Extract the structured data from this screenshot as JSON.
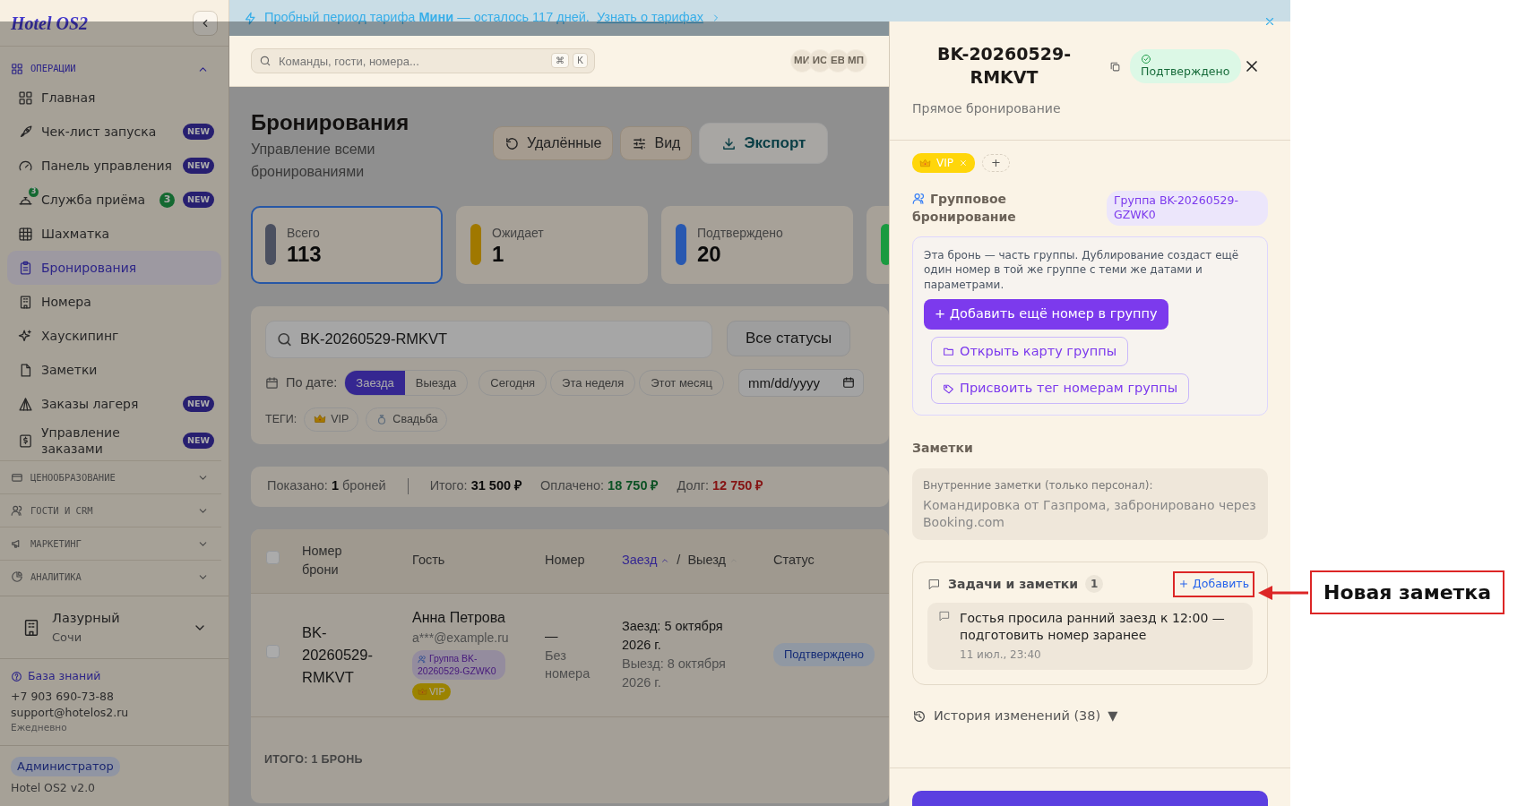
{
  "banner": {
    "text": "Пробный период тарифа **Мини** — осталось 117 дней.",
    "link": "Узнать о тарифах"
  },
  "sidebar": {
    "logo": "Hotel OS2",
    "sections": [
      {
        "title": "ОПЕРАЦИИ",
        "expanded": true,
        "items": [
          {
            "label": "Главная",
            "selected": false
          },
          {
            "label": "Чек-лист запуска",
            "badge": "NEW",
            "selected": false
          },
          {
            "label": "Панель управления",
            "badge": "NEW",
            "selected": false
          },
          {
            "label": "Служба приёма",
            "icon_count": "3",
            "count": "3",
            "badge": "NEW",
            "selected": false
          },
          {
            "label": "Шахматка",
            "selected": false
          },
          {
            "label": "Бронирования",
            "selected": true
          },
          {
            "label": "Номера",
            "selected": false
          },
          {
            "label": "Хаускипинг",
            "selected": false
          },
          {
            "label": "Заметки",
            "selected": false
          },
          {
            "label": "Заказы лагеря",
            "badge": "NEW",
            "selected": false
          },
          {
            "label": "Управление заказами",
            "badge": "NEW",
            "selected": false
          }
        ]
      },
      {
        "title": "ЦЕНООБРАЗОВАНИЕ",
        "expanded": false
      },
      {
        "title": "ГОСТИ И CRM",
        "expanded": false
      },
      {
        "title": "МАРКЕТИНГ",
        "expanded": false
      },
      {
        "title": "АНАЛИТИКА",
        "expanded": false
      }
    ],
    "property": {
      "name": "Лазурный",
      "city": "Сочи"
    },
    "help": {
      "link": "База знаний",
      "phone": "+7 903 690-73-88",
      "email": "support@hotelos2.ru",
      "hours": "Ежедневно"
    },
    "role": "Администратор",
    "version": "Hotel OS2 v2.0"
  },
  "topbar": {
    "search": {
      "placeholder": "Команды, гости, номера..."
    },
    "shortcut": [
      "⌘",
      "K"
    ],
    "avatars": [
      "МИ",
      "ИС",
      "ЕВ",
      "МП"
    ]
  },
  "page": {
    "title": "Бронирования",
    "subtitle": "Управление всеми бронированиями",
    "actions": [
      {
        "label": "Удалённые",
        "kind": "restore"
      },
      {
        "label": "Вид",
        "kind": "view"
      },
      {
        "label": "Экспорт",
        "kind": "export"
      }
    ]
  },
  "stats": [
    {
      "label": "Всего",
      "value": "113",
      "color": "#4b5060",
      "selected": true
    },
    {
      "label": "Ожидает",
      "value": "1",
      "color": "#a07800",
      "selected": false
    },
    {
      "label": "Подтверждено",
      "value": "20",
      "color": "#2858b0",
      "selected": false
    },
    {
      "color": "#1a9a40",
      "selected": false
    }
  ],
  "filters": {
    "search": {
      "value": "BK-20260529-RMKVT"
    },
    "status": "Все статусы",
    "date_label": "По дате:",
    "date_modes": [
      {
        "label": "Заезда",
        "selected": true
      },
      {
        "label": "Выезда",
        "selected": false
      }
    ],
    "quick": [
      "Сегодня",
      "Эта неделя",
      "Этот месяц"
    ],
    "date": {
      "placeholder": "mm/dd/yyyy"
    },
    "tags_label": "ТЕГИ:",
    "tags": [
      {
        "label": "VIP",
        "kind": "crown"
      },
      {
        "label": "Свадьба",
        "kind": "ring"
      }
    ]
  },
  "summary": {
    "shown": "Показано: **1** броней",
    "totals": [
      {
        "label": "Итого:",
        "value": "31 500 ₽",
        "kind": "total"
      },
      {
        "label": "Оплачено:",
        "value": "18 750 ₽",
        "kind": "paid"
      },
      {
        "label": "Долг:",
        "value": "12 750 ₽",
        "kind": "debt"
      }
    ]
  },
  "table": {
    "select_all": {
      "checked": false
    },
    "columns": [
      {
        "label": "Номер брони"
      },
      {
        "label": "Гость"
      },
      {
        "label": "Номер"
      },
      {
        "label": "Заезд",
        "sorted": true
      },
      {
        "label": "Выезд",
        "sorted": false
      },
      {
        "label": "Статус"
      }
    ],
    "date_separator": "/",
    "rows": [
      {
        "checked": false,
        "booking": "BK-20260529-RMKVT",
        "guest": "Анна Петрова",
        "email": "a***@example.ru",
        "group": "Группа BK-20260529-GZWK0",
        "tags": [
          "VIP"
        ],
        "room": "—",
        "room_note": "Без номера",
        "checkin": "Заезд: 5 октября 2026 г.",
        "checkout": "Выезд: 8 октября 2026 г.",
        "status": "Подтверждено"
      }
    ],
    "footer": "ИТОГО: 1 БРОНЬ"
  },
  "drawer": {
    "title": "BK-20260529-RMKVT",
    "status": "Подтверждено",
    "subtitle": "Прямое бронирование",
    "tags": [
      {
        "label": "VIP"
      }
    ],
    "add_tag": "+",
    "group": {
      "title": "Групповое бронирование",
      "badge": "Группа BK-20260529-GZWK0",
      "info": "Эта бронь — часть группы. Дублирование создаст ещё один номер в той же группе с теми же датами и параметрами.",
      "buttons": [
        {
          "label": "+ Добавить ещё номер в группу",
          "kind": "primary"
        },
        {
          "label": "Открыть карту группы",
          "kind": "map"
        },
        {
          "label": "Присвоить тег номерам группы",
          "kind": "tag"
        }
      ]
    },
    "notes": {
      "title": "Заметки",
      "label": "Внутренние заметки (только персонал):",
      "text": "Командировка от Газпрома, забронировано через Booking.com"
    },
    "tasks": {
      "title": "Задачи и заметки",
      "count": "1",
      "add": {
        "label": "Добавить",
        "highlighted": true
      },
      "items": [
        {
          "text": "Гостья просила ранний заезд к 12:00 — подготовить номер заранее",
          "time": "11 июл., 23:40"
        }
      ]
    },
    "history": {
      "label": "История изменений (38)",
      "toggle": "▼"
    }
  },
  "callout": {
    "label": "Новая заметка"
  }
}
